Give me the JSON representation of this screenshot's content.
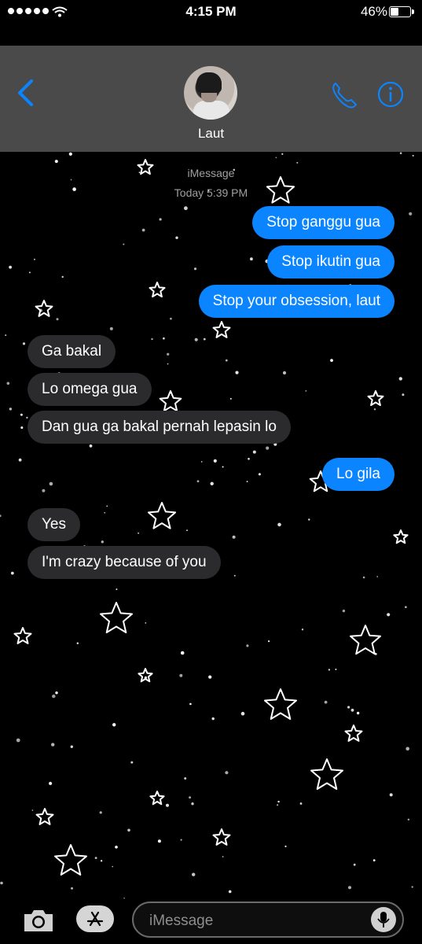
{
  "status_bar": {
    "time": "4:15 PM",
    "battery": "46%"
  },
  "header": {
    "contact_name": "Laut"
  },
  "thread": {
    "service": "iMessage",
    "timestamp": "Today 5:39 PM",
    "messages": [
      {
        "dir": "out",
        "text": "Stop ganggu gua"
      },
      {
        "dir": "out",
        "text": "Stop ikutin gua"
      },
      {
        "dir": "out",
        "text": "Stop your obsession, laut"
      },
      {
        "dir": "in",
        "text": "Ga bakal"
      },
      {
        "dir": "in",
        "text": "Lo omega gua"
      },
      {
        "dir": "in",
        "text": "Dan gua ga bakal pernah lepasin lo"
      },
      {
        "dir": "out",
        "text": "Lo gila"
      },
      {
        "dir": "in",
        "text": "Yes"
      },
      {
        "dir": "in",
        "text": "I'm crazy because of you"
      }
    ]
  },
  "composer": {
    "placeholder": "iMessage"
  },
  "icons": {
    "back": "chevron-left-icon",
    "call": "phone-icon",
    "info": "info-icon",
    "camera": "camera-icon",
    "apps": "app-store-icon",
    "mic": "microphone-icon",
    "wifi": "wifi-icon",
    "battery": "battery-icon"
  },
  "colors": {
    "accent": "#0a84ff",
    "incoming_bubble": "#2b2b2d",
    "header_bg": "#4a4a4a"
  }
}
